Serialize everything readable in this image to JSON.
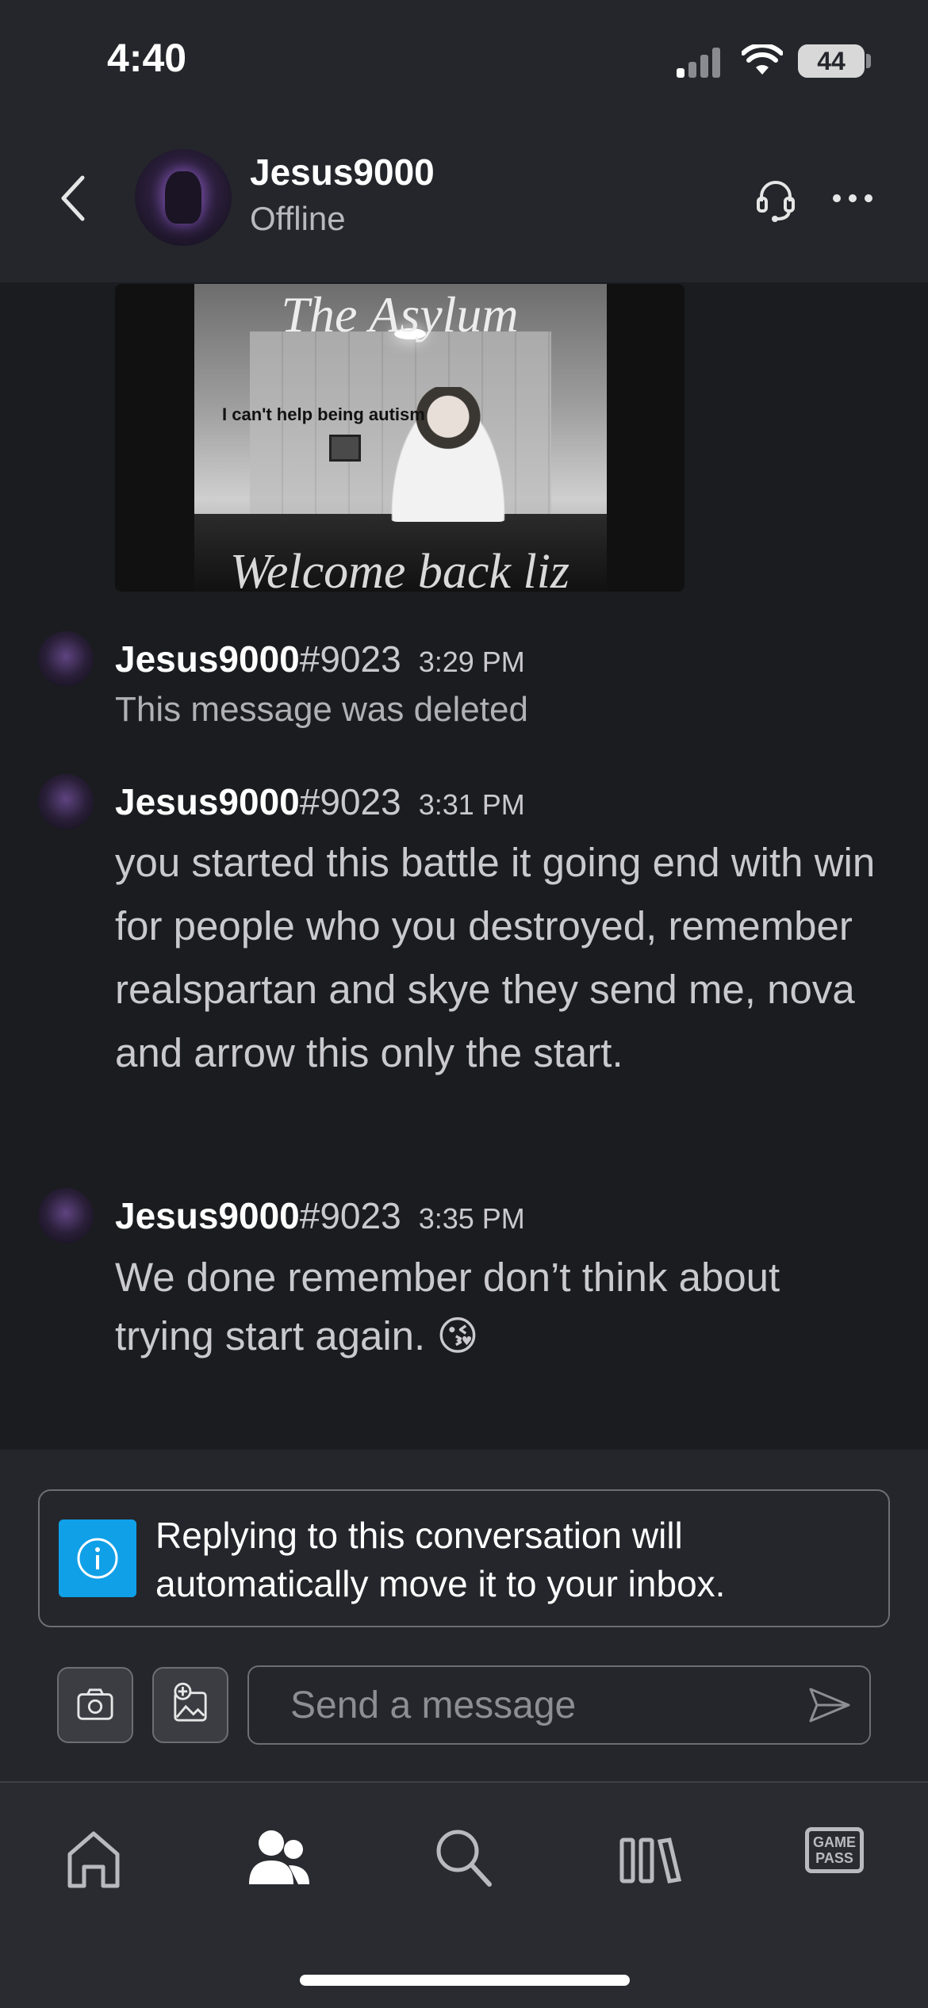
{
  "status_bar": {
    "time": "4:40",
    "battery": "44"
  },
  "header": {
    "name": "Jesus9000",
    "status": "Offline"
  },
  "image_message": {
    "title": "The Asylum",
    "caption": "I can't help being autism",
    "footer": "Welcome back liz"
  },
  "messages": [
    {
      "author": "Jesus9000",
      "tag": "#9023",
      "time": "3:29 PM",
      "text": "This message was deleted"
    },
    {
      "author": "Jesus9000",
      "tag": "#9023",
      "time": "3:31 PM",
      "text": "you started this battle it going end with win for people who you destroyed, remember realspartan and skye they send me, nova and arrow this only the start."
    },
    {
      "author": "Jesus9000",
      "tag": "#9023",
      "time": "3:35 PM",
      "text": "We done remember don’t think about trying start again. 😘"
    }
  ],
  "notice": {
    "text": "Replying to this conversation will automatically move it to your inbox."
  },
  "composer": {
    "placeholder": "Send a message"
  },
  "nav": {
    "items": [
      {
        "icon": "home-icon"
      },
      {
        "icon": "people-icon",
        "active": true
      },
      {
        "icon": "search-icon"
      },
      {
        "icon": "library-icon"
      },
      {
        "icon": "game-pass-icon",
        "line1": "GAME",
        "line2": "PASS"
      }
    ]
  },
  "colors": {
    "background": "#1b1c20",
    "header": "#24262b",
    "accent": "#10a0e8",
    "nav": "#2a2b30"
  }
}
